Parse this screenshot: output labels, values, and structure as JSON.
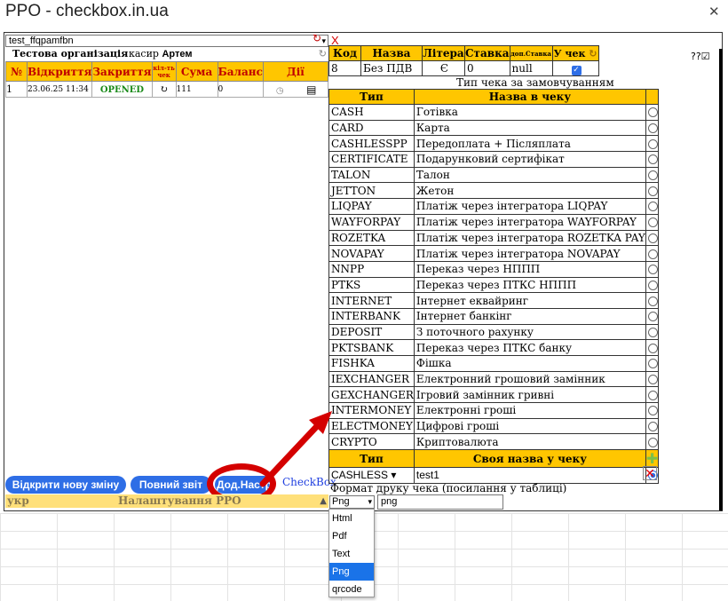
{
  "window": {
    "title": "PPO - checkbox.in.ua",
    "close": "✕"
  },
  "left": {
    "workspace_value": "test_ffqpamfbn",
    "org_name": "Тестова організація",
    "cashier_label": "касир",
    "cashier_name": "Артем",
    "shifts_headers": [
      "№",
      "Відкриття",
      "Закриття",
      "кіл-ть чек",
      "Сума",
      "Баланс",
      "Дії"
    ],
    "shifts_rows": [
      {
        "num": "1",
        "opened": "23.06.25 11:34",
        "status": "OPENED",
        "count": "↻",
        "sum": "111",
        "balance": "0"
      }
    ],
    "buttons": {
      "open_shift": "Відкрити нову зміну",
      "full_report": "Повний звіт",
      "more_settings": "Дод.Настр",
      "checkbox_link": "CheckBox"
    },
    "footer": {
      "lang": "укр",
      "settings": "Налаштування РРО"
    }
  },
  "tax": {
    "headers": [
      "Код",
      "Назва",
      "Літера",
      "Ставка",
      "доп.Ставка",
      "У чек"
    ],
    "row": {
      "code": "8",
      "name": "Без ПДВ",
      "letter": "Є",
      "rate": "0",
      "extra": "null"
    }
  },
  "order_title": "Тип чека за замовчуванням",
  "types_headers": [
    "Тип",
    "Назва в чеку"
  ],
  "payment_types": [
    {
      "code": "CASH",
      "name": "Готівка"
    },
    {
      "code": "CARD",
      "name": "Карта"
    },
    {
      "code": "CASHLESSPP",
      "name": "Передоплата + Післяплата"
    },
    {
      "code": "CERTIFICATE",
      "name": "Подарунковий сертифікат"
    },
    {
      "code": "TALON",
      "name": "Талон"
    },
    {
      "code": "JETTON",
      "name": "Жетон"
    },
    {
      "code": "LIQPAY",
      "name": "Платіж через інтегратора LIQPAY"
    },
    {
      "code": "WAYFORPAY",
      "name": "Платіж через інтегратора WAYFORPAY"
    },
    {
      "code": "ROZETKA",
      "name": "Платіж через інтегратора ROZETKA PAY"
    },
    {
      "code": "NOVAPAY",
      "name": "Платіж через інтегратора NOVAPAY"
    },
    {
      "code": "NNPP",
      "name": "Переказ через НППП"
    },
    {
      "code": "PTKS",
      "name": "Переказ через ПТКС НППП"
    },
    {
      "code": "INTERNET",
      "name": "Інтернет еквайринг"
    },
    {
      "code": "INTERBANK",
      "name": "Інтернет банкінг"
    },
    {
      "code": "DEPOSIT",
      "name": "З поточного рахунку"
    },
    {
      "code": "PKTSBANK",
      "name": "Переказ через ПТКС банку"
    },
    {
      "code": "FISHKA",
      "name": "Фішка"
    },
    {
      "code": "IEXCHANGER",
      "name": "Електронний грошовий замінник"
    },
    {
      "code": "GEXCHANGER",
      "name": "Ігровий замінник гривні"
    },
    {
      "code": "INTERMONEY",
      "name": "Електронні гроші"
    },
    {
      "code": "ELECTMONEY",
      "name": "Цифрові гроші"
    },
    {
      "code": "CRYPTO",
      "name": "Криптовалюта"
    }
  ],
  "own_headers": [
    "Тип",
    "Своя назва у чеку"
  ],
  "own_row": {
    "type": "CASHLESS",
    "name": "test1"
  },
  "format": {
    "label": "Формат друку чека (посилання у таблиці)",
    "selected": "Png",
    "input": "png",
    "options": [
      "Html",
      "Pdf",
      "Text",
      "Png",
      "qrcode"
    ]
  },
  "misc": {
    "close_x": "X",
    "qq": "??☑"
  },
  "colors": {
    "header_yellow": "#ffc600",
    "button_blue": "#2e6ee6",
    "annotation_red": "#d40000"
  }
}
